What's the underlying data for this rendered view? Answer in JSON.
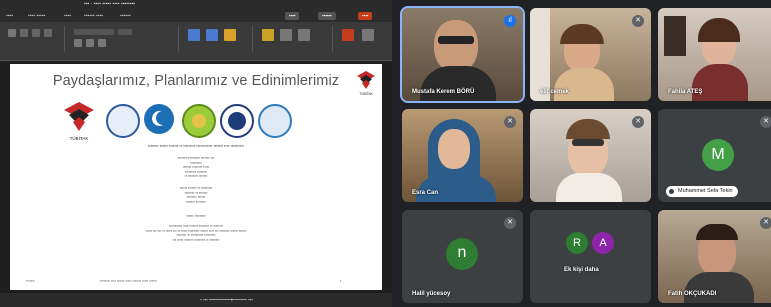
{
  "presentation": {
    "slide_title": "Paydaşlarımız, Planlarımız ve Edinimlerimiz",
    "corner_logo_caption": "TÜBİTAK",
    "left_logo_caption": "TÜBİTAK"
  },
  "participants": [
    {
      "name": "Mustafa Kerem BÖRÜ",
      "mic": "speaking"
    },
    {
      "name": "elif cemek",
      "mic": "muted"
    },
    {
      "name": "Fahila ATEŞ",
      "mic": "none"
    },
    {
      "name": "Esra Can",
      "mic": "muted"
    },
    {
      "name": "",
      "mic": "muted"
    },
    {
      "name": "Muhammet Sefa Tekin",
      "initial": "M",
      "avatar_color": "#43a047",
      "mic": "muted"
    },
    {
      "name": "Halil yücesoy",
      "initial": "n",
      "avatar_color": "#2e7d32",
      "mic": "muted"
    },
    {
      "name": "Ek kişi daha",
      "initials": [
        "R",
        "A"
      ],
      "avatar_colors": [
        "#2e7d32",
        "#8e24aa"
      ],
      "mic": "none"
    },
    {
      "name": "Fatih OKÇUKADI",
      "mic": "muted"
    }
  ],
  "colors": {
    "speaking_outline": "#8ab4f8",
    "speaking_mic": "#1a73e8",
    "ribbon_bg": "#3a3a3a"
  }
}
